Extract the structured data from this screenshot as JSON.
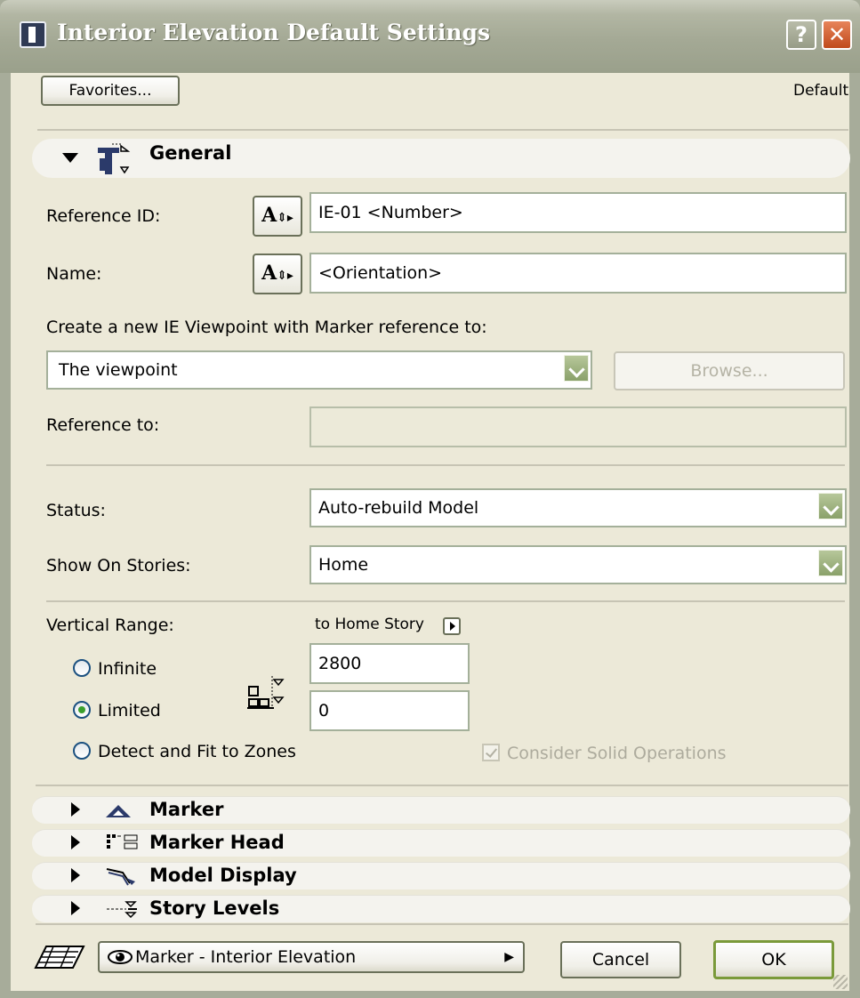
{
  "window": {
    "title": "Interior Elevation Default Settings",
    "help": "?",
    "close": "✕"
  },
  "toolbar": {
    "favorites_label": "Favorites...",
    "preset_name": "Default"
  },
  "sections": {
    "general": "General",
    "marker": "Marker",
    "marker_head": "Marker Head",
    "model_display": "Model Display",
    "story_levels": "Story Levels"
  },
  "general": {
    "reference_id_label": "Reference ID:",
    "reference_id_value": "IE-01 <Number>",
    "autotext_label": "A",
    "name_label": "Name:",
    "name_value": "<Orientation>",
    "create_label": "Create a new IE Viewpoint with Marker reference to:",
    "viewpoint_value": "The viewpoint",
    "browse_label": "Browse...",
    "reference_to_label": "Reference to:",
    "reference_to_value": "",
    "status_label": "Status:",
    "status_value": "Auto-rebuild Model",
    "show_on_stories_label": "Show On Stories:",
    "show_on_stories_value": "Home",
    "vertical_range_label": "Vertical Range:",
    "to_home_story": "to Home Story",
    "radio_infinite": "Infinite",
    "radio_limited": "Limited",
    "radio_detect": "Detect and Fit to Zones",
    "selected_range": "Limited",
    "top_value": "2800",
    "bottom_value": "0",
    "consider_solid": "Consider Solid Operations",
    "consider_solid_checked": true
  },
  "footer": {
    "marker_selector": "Marker - Interior Elevation",
    "cancel_label": "Cancel",
    "ok_label": "OK"
  },
  "icons": [
    "interior-elevation-window-icon",
    "general-section-icon",
    "marker-triangle-icon",
    "marker-head-icon",
    "model-display-icon",
    "story-levels-icon",
    "layer-icon",
    "eye-icon",
    "vertical-range-icon"
  ]
}
